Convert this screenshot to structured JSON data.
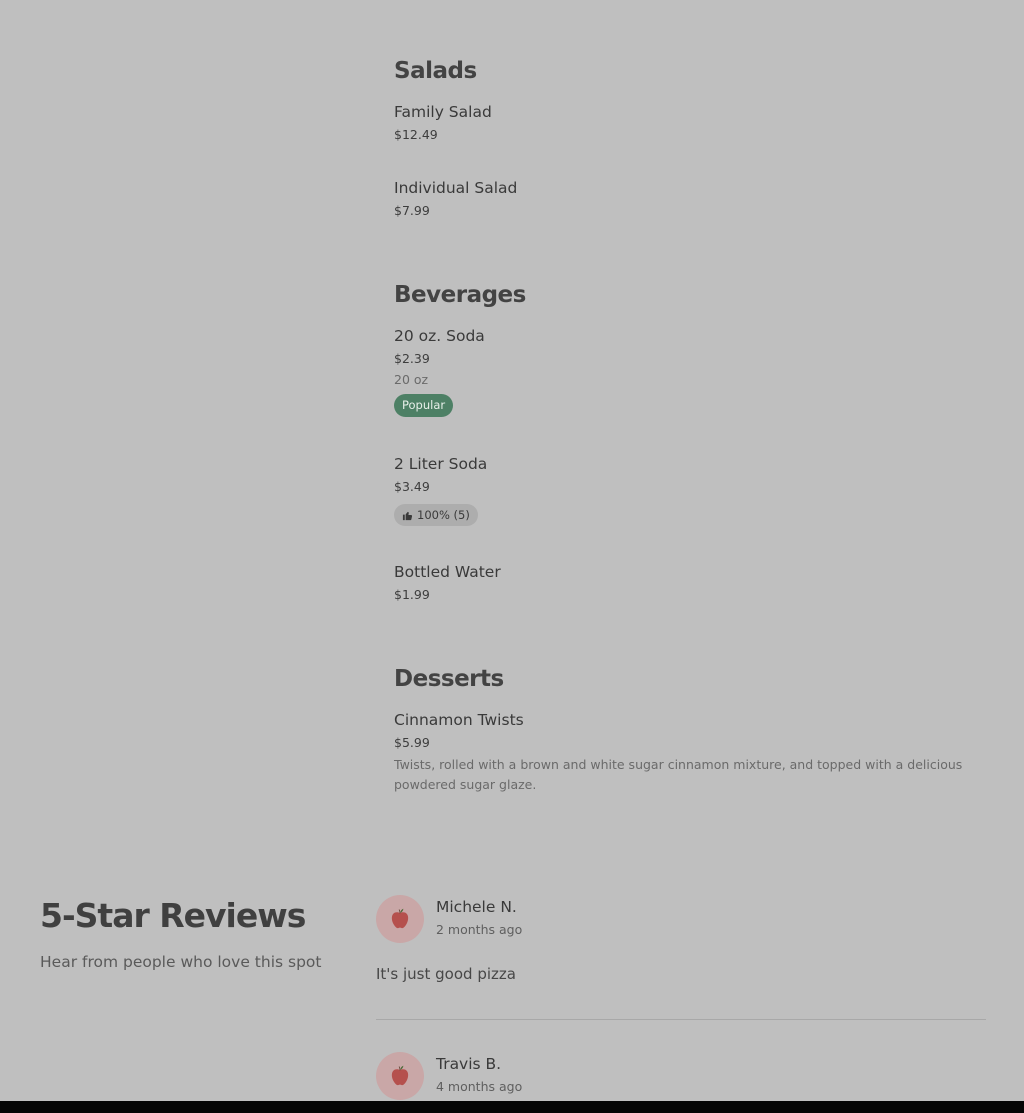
{
  "menu": {
    "sections": [
      {
        "title": "Salads",
        "items": [
          {
            "name": "Family Salad",
            "price": "$12.49"
          },
          {
            "name": "Individual Salad",
            "price": "$7.99"
          }
        ]
      },
      {
        "title": "Beverages",
        "items": [
          {
            "name": "20 oz. Soda",
            "price": "$2.39",
            "desc": "20 oz",
            "badge": "Popular"
          },
          {
            "name": "2 Liter Soda",
            "price": "$3.49",
            "rating": "100% (5)"
          },
          {
            "name": "Bottled Water",
            "price": "$1.99"
          }
        ]
      },
      {
        "title": "Desserts",
        "items": [
          {
            "name": "Cinnamon Twists",
            "price": "$5.99",
            "desc": "Twists, rolled with a brown and white sugar cinnamon mixture, and topped with a delicious powdered sugar glaze."
          }
        ]
      }
    ]
  },
  "reviews": {
    "heading": "5-Star Reviews",
    "subheading": "Hear from people who love this spot",
    "items": [
      {
        "name": "Michele N.",
        "time": "2 months ago",
        "text": "It's just good pizza",
        "avatar_icon": "apple-icon"
      },
      {
        "name": "Travis B.",
        "time": "4 months ago",
        "avatar_icon": "apple-icon"
      }
    ]
  },
  "colors": {
    "background": "#bfbfbf",
    "popular_badge": "#4d8065",
    "avatar_bg": "#c9a7a7",
    "apple": "#b5504d"
  }
}
